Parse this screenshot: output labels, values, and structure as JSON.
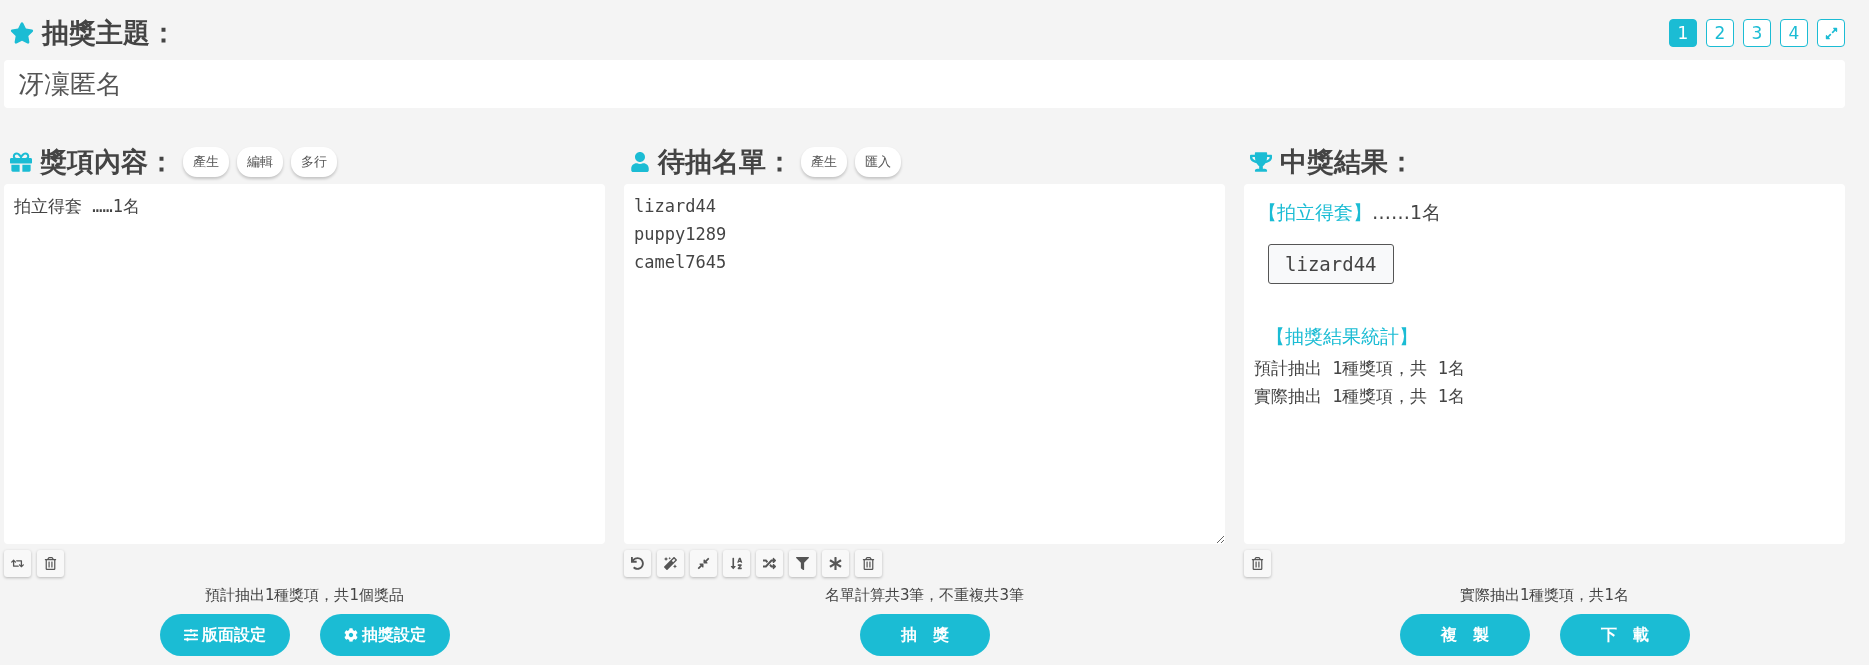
{
  "topic": {
    "label": "抽獎主題：",
    "value": "冴凜匿名"
  },
  "pages": [
    {
      "label": "1",
      "selected": true
    },
    {
      "label": "2",
      "selected": false
    },
    {
      "label": "3",
      "selected": false
    },
    {
      "label": "4",
      "selected": false
    }
  ],
  "prizes": {
    "title": "獎項內容：",
    "tags": [
      "產生",
      "編輯",
      "多行"
    ],
    "text": "拍立得套 ……1名",
    "tools": [
      {
        "kind": "swap"
      },
      {
        "kind": "trash"
      }
    ],
    "summary": "預計抽出1種獎項，共1個獎品",
    "buttons": [
      {
        "kind": "sliders",
        "label": "版面設定"
      },
      {
        "kind": "gear",
        "label": "抽獎設定"
      }
    ]
  },
  "candidates": {
    "title": "待抽名單：",
    "tags": [
      "產生",
      "匯入"
    ],
    "text": "lizard44\npuppy1289\ncamel7645",
    "tools": [
      {
        "kind": "undo"
      },
      {
        "kind": "wand"
      },
      {
        "kind": "compress"
      },
      {
        "kind": "sort"
      },
      {
        "kind": "shuffle"
      },
      {
        "kind": "filter"
      },
      {
        "kind": "asterisk"
      },
      {
        "kind": "trash"
      }
    ],
    "summary": "名單計算共3筆，不重複共3筆",
    "buttons": [
      {
        "label": "抽　獎"
      }
    ]
  },
  "results": {
    "title": "中獎結果：",
    "prize": "【拍立得套】",
    "count": "……1名",
    "winners": [
      "lizard44"
    ],
    "stats_title": "【抽獎結果統計】",
    "stats": [
      "預計抽出 1種獎項，共 1名",
      "實際抽出 1種獎項，共 1名"
    ],
    "tools": [
      {
        "kind": "trash"
      }
    ],
    "summary": "實際抽出1種獎項，共1名",
    "buttons": [
      {
        "label": "複　製"
      },
      {
        "label": "下　載"
      }
    ]
  }
}
